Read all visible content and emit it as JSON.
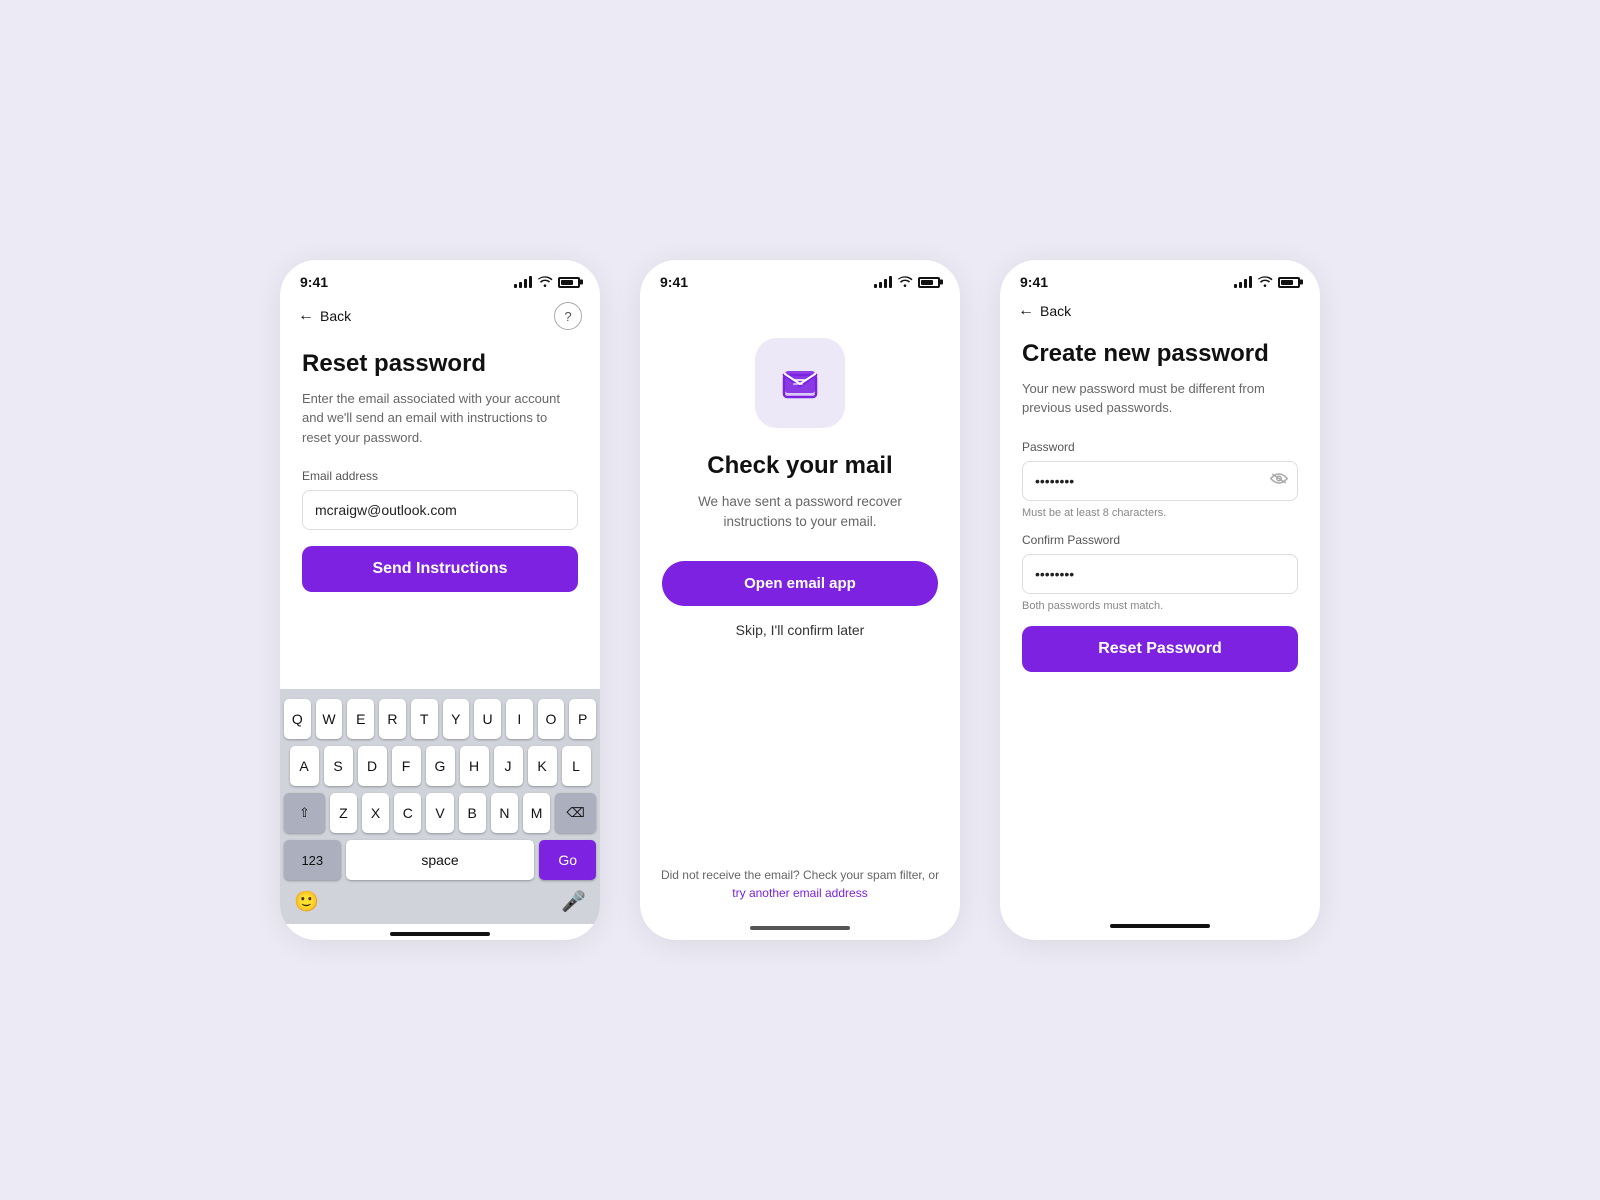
{
  "bg_color": "#eceaf5",
  "accent_color": "#7c22e0",
  "phone1": {
    "status_bar": {
      "time": "9:41"
    },
    "nav": {
      "back_label": "Back",
      "help_icon": "?"
    },
    "title": "Reset password",
    "subtitle": "Enter the email associated with your account and we'll send an email with instructions to reset your password.",
    "email_label": "Email address",
    "email_value": "mcraigw@outlook.com",
    "email_placeholder": "mcraigw@outlook.com",
    "send_button": "Send Instructions",
    "keyboard": {
      "row1": [
        "Q",
        "W",
        "E",
        "R",
        "T",
        "Y",
        "U",
        "I",
        "O",
        "P"
      ],
      "row2": [
        "A",
        "S",
        "D",
        "F",
        "G",
        "H",
        "J",
        "K",
        "L"
      ],
      "row3": [
        "Z",
        "X",
        "C",
        "V",
        "B",
        "N",
        "M"
      ],
      "numbers_label": "123",
      "space_label": "space",
      "go_label": "Go"
    }
  },
  "phone2": {
    "status_bar": {
      "time": "9:41"
    },
    "mail_icon_label": "email-open-icon",
    "title": "Check your mail",
    "subtitle": "We have sent a password recover instructions to your email.",
    "open_email_btn": "Open email app",
    "skip_link": "Skip, I'll confirm later",
    "footer_text_prefix": "Did not receive the email? Check your spam filter,\nor ",
    "footer_link_text": "try another email address",
    "footer_link_href": "#"
  },
  "phone3": {
    "status_bar": {
      "time": "9:41"
    },
    "nav": {
      "back_label": "Back"
    },
    "title": "Create new password",
    "subtitle": "Your new password must be different from previous used passwords.",
    "password_label": "Password",
    "password_value": "••••••••",
    "password_hint": "Must be at least 8 characters.",
    "confirm_label": "Confirm Password",
    "confirm_value": "••••••••",
    "confirm_hint": "Both passwords must match.",
    "reset_btn": "Reset Password",
    "eye_icon": "👁"
  }
}
